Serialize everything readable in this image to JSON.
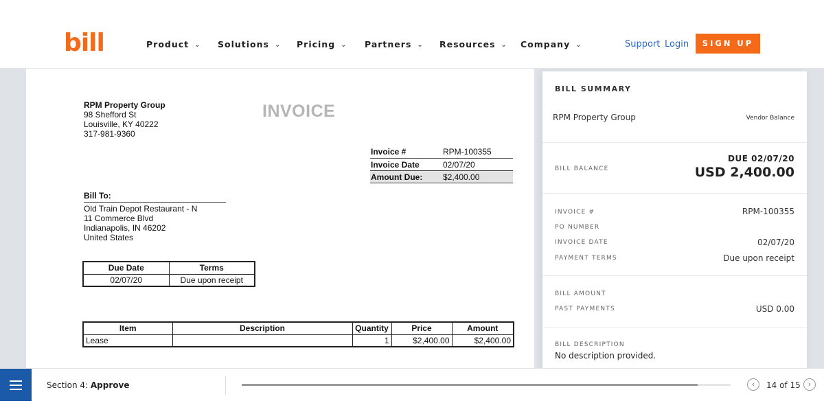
{
  "header": {
    "logo": "bill",
    "nav": [
      {
        "label": "Product"
      },
      {
        "label": "Solutions"
      },
      {
        "label": "Pricing"
      },
      {
        "label": "Partners"
      },
      {
        "label": "Resources"
      },
      {
        "label": "Company"
      }
    ],
    "support": "Support",
    "login": "Login",
    "signup": "SIGN UP",
    "accent_color": "#f46a19",
    "link_color": "#2d6bbf"
  },
  "invoice": {
    "title": "INVOICE",
    "vendor": {
      "name": "RPM Property Group",
      "address1": "98 Shefford St",
      "address2": "Louisville, KY 40222",
      "phone": "317-981-9360"
    },
    "meta": {
      "invoice_no_label": "Invoice #",
      "invoice_no": "RPM-100355",
      "invoice_date_label": "Invoice Date",
      "invoice_date": "02/07/20",
      "amount_due_label": "Amount Due:",
      "amount_due": "$2,400.00"
    },
    "bill_to": {
      "label": "Bill To:",
      "name": "Old Train Depot Restaurant - N",
      "address1": "11 Commerce Blvd",
      "address2": "Indianapolis, IN 46202",
      "country": "United States"
    },
    "terms_table": {
      "headers": [
        "Due Date",
        "Terms"
      ],
      "row": [
        "02/07/20",
        "Due upon receipt"
      ]
    },
    "items_table": {
      "headers": [
        "Item",
        "Description",
        "Quantity",
        "Price",
        "Amount"
      ],
      "rows": [
        [
          "Lease",
          "",
          "1",
          "$2,400.00",
          "$2,400.00"
        ]
      ]
    }
  },
  "summary": {
    "title": "BILL SUMMARY",
    "vendor": "RPM Property Group",
    "vendor_balance": "Vendor Balance",
    "bill_balance_label": "BILL BALANCE",
    "due_date": "DUE 02/07/20",
    "due_amount": "USD 2,400.00",
    "invoice_no_label": "INVOICE #",
    "invoice_no": "RPM-100355",
    "po_label": "PO NUMBER",
    "invoice_date_label": "INVOICE DATE",
    "invoice_date": "02/07/20",
    "payment_terms_label": "PAYMENT TERMS",
    "payment_terms": "Due upon receipt",
    "bill_amount_label": "BILL AMOUNT",
    "past_payments_label": "PAST PAYMENTS",
    "past_payments": "USD 0.00",
    "description_label": "BILL DESCRIPTION",
    "description": "No description provided."
  },
  "footer": {
    "section_prefix": "Section 4: ",
    "section_name": "Approve",
    "progress_fraction": 0.933,
    "page_count": "14 of 15",
    "prev_icon": "chevron-left-icon",
    "next_icon": "chevron-right-icon",
    "menu_icon": "hamburger-menu-icon",
    "menu_color": "#1a5aa8"
  }
}
